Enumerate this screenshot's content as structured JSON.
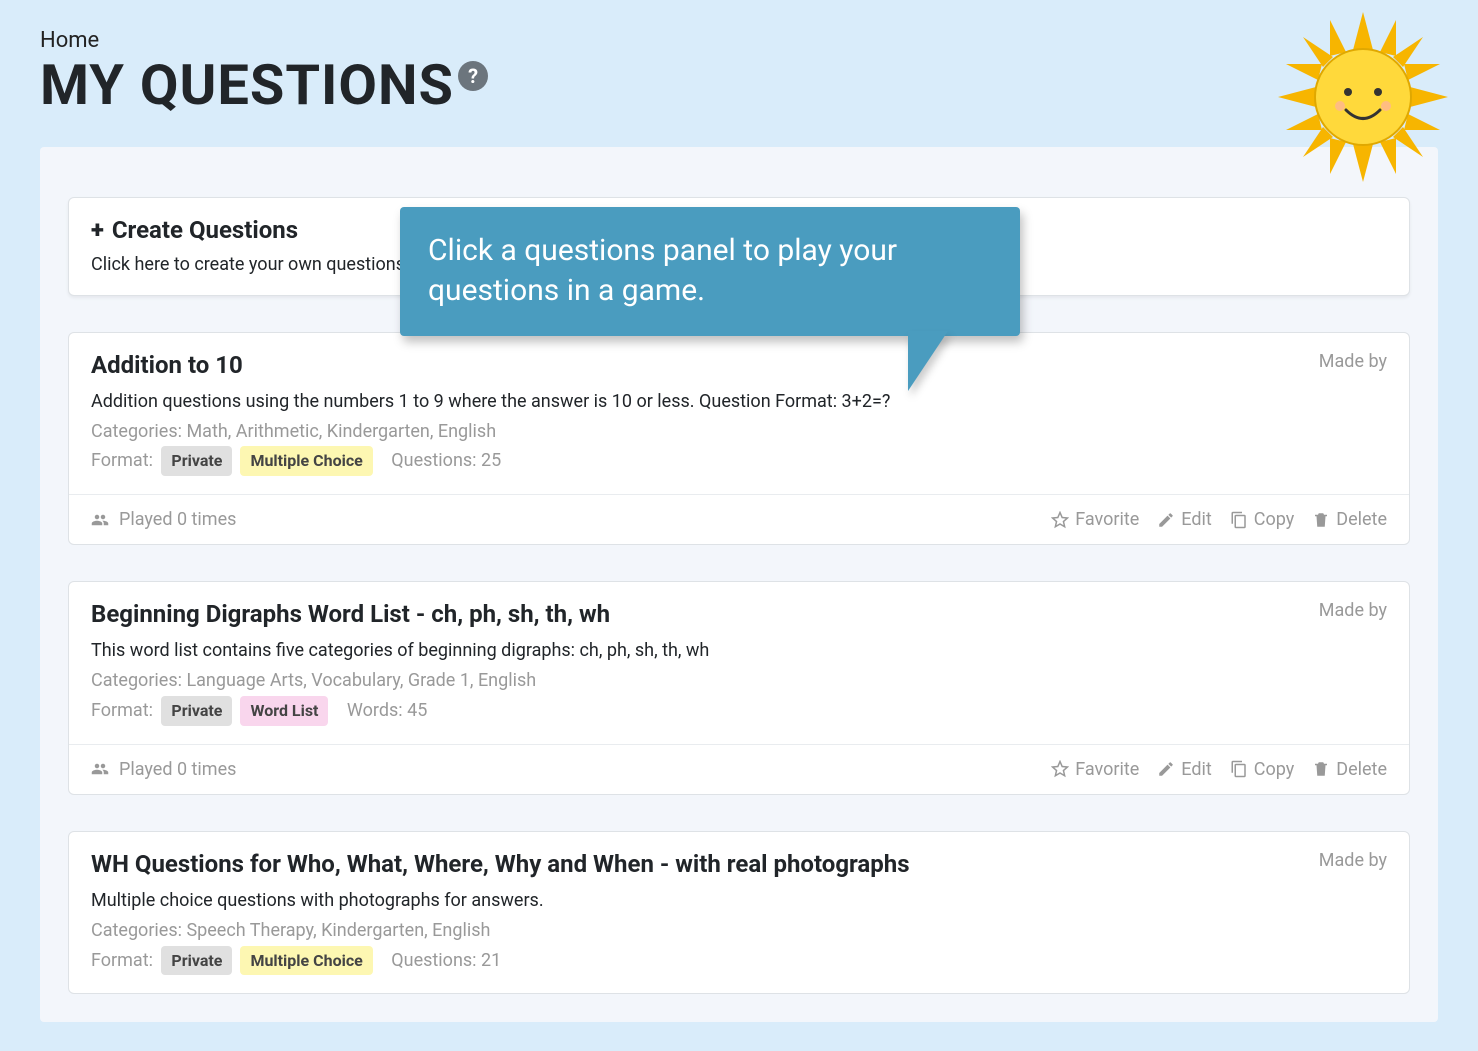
{
  "breadcrumb": "Home",
  "page_title": "MY QUESTIONS",
  "help_icon": "?",
  "tooltip": "Click a questions panel to play your questions in a game.",
  "create": {
    "title": "Create Questions",
    "subtitle": "Click here to create your own questions."
  },
  "labels": {
    "made_by": "Made by",
    "categories_prefix": "Categories:",
    "format_prefix": "Format:",
    "played_prefix": "Played",
    "favorite": "Favorite",
    "edit": "Edit",
    "copy": "Copy",
    "delete": "Delete"
  },
  "questions": [
    {
      "title": "Addition to 10",
      "description": "Addition questions using the numbers 1 to 9 where the answer is 10 or less. Question Format: 3+2=?",
      "categories": "Math, Arithmetic, Kindergarten, English",
      "privacy": "Private",
      "format_badge": "Multiple Choice",
      "format_badge_class": "badge-yellow",
      "count_label": "Questions: 25",
      "played": "0 times"
    },
    {
      "title": "Beginning Digraphs Word List - ch, ph, sh, th, wh",
      "description": "This word list contains five categories of beginning digraphs: ch, ph, sh, th, wh",
      "categories": "Language Arts, Vocabulary, Grade 1, English",
      "privacy": "Private",
      "format_badge": "Word List",
      "format_badge_class": "badge-pink",
      "count_label": "Words: 45",
      "played": "0 times"
    },
    {
      "title": "WH Questions for Who, What, Where, Why and When - with real photographs",
      "description": "Multiple choice questions with photographs for answers.",
      "categories": "Speech Therapy, Kindergarten, English",
      "privacy": "Private",
      "format_badge": "Multiple Choice",
      "format_badge_class": "badge-yellow",
      "count_label": "Questions: 21",
      "played": null
    }
  ]
}
